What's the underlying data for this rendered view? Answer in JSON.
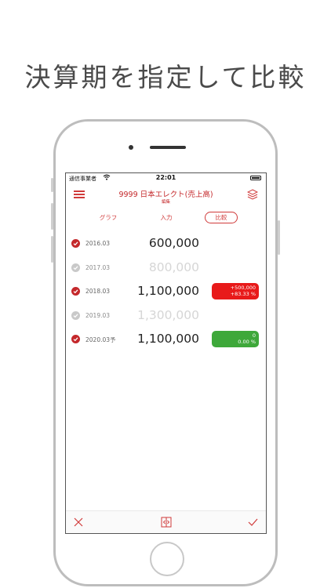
{
  "headline": "決算期を指定して比較",
  "status": {
    "carrier": "通信事業者",
    "time": "22:01"
  },
  "nav": {
    "title": "9999 日本エレクト(売上高)",
    "subtitle": "編集"
  },
  "tabs": [
    {
      "label": "グラフ",
      "active": false
    },
    {
      "label": "入力",
      "active": false
    },
    {
      "label": "比較",
      "active": true
    }
  ],
  "rows": [
    {
      "period": "2016.03",
      "amount": "600,000",
      "checked": true
    },
    {
      "period": "2017.03",
      "amount": "800,000",
      "checked": false
    },
    {
      "period": "2018.03",
      "amount": "1,100,000",
      "checked": true,
      "diff_value": "+500,000",
      "diff_percent": "+83.33 %"
    },
    {
      "period": "2019.03",
      "amount": "1,300,000",
      "checked": false
    },
    {
      "period": "2020.03予",
      "amount": "1,100,000",
      "checked": true,
      "diff_value": "0",
      "diff_percent": "0.00 %"
    }
  ],
  "colors": {
    "accent": "#c4282b",
    "increase": "#e81a1a",
    "unchanged": "#3ea83a"
  },
  "icons": {
    "menu": "menu-icon",
    "layers": "layers-icon",
    "cancel": "close-icon",
    "compare_toggle": "split-icon",
    "confirm": "checkmark-icon"
  }
}
